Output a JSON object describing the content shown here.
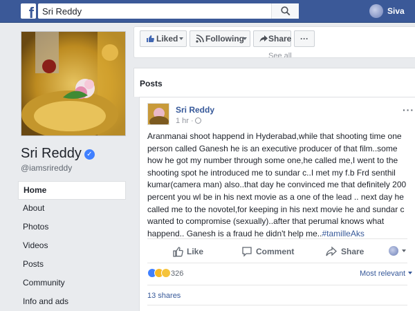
{
  "topbar": {
    "logo": "f",
    "search_value": "Sri Reddy",
    "user_name": "Siva"
  },
  "page": {
    "name": "Sri Reddy",
    "handle": "@iamsrireddy"
  },
  "nav": {
    "items": [
      {
        "label": "Home",
        "active": true
      },
      {
        "label": "About"
      },
      {
        "label": "Photos"
      },
      {
        "label": "Videos"
      },
      {
        "label": "Posts"
      },
      {
        "label": "Community"
      },
      {
        "label": "Info and ads"
      }
    ]
  },
  "actions": {
    "liked": "Liked",
    "following": "Following",
    "share": "Share",
    "more": "···",
    "see_all": "See all"
  },
  "posts_section": {
    "title": "Posts"
  },
  "post": {
    "author": "Sri Reddy",
    "time": "1 hr ·",
    "more": "···",
    "text": "Aranmanai shoot happend in Hyderabad,while that shooting time one person called Ganesh he is an executive producer of that film..some how he got my number through some one,he called me,I went to the shooting spot he introduced me to sundar c..I met my f.b Frd senthil kumar(camera man) also..that day he convinced me that definitely 200 percent you wl be in his next movie as a one of the lead .. next day he called me to the novotel,for keeping in his next movie he and sundar c wanted to compromise (sexually)..after that perumal knows what happend.. Ganesh is a fraud he didn't help me..",
    "hashtag": "#tamilleAks",
    "like_label": "Like",
    "comment_label": "Comment",
    "share_label": "Share",
    "reaction_count": "326",
    "sort_label": "Most relevant",
    "shares": "13 shares"
  },
  "colors": {
    "brand": "#3b5998",
    "link": "#365899",
    "background": "#e9ebee"
  }
}
